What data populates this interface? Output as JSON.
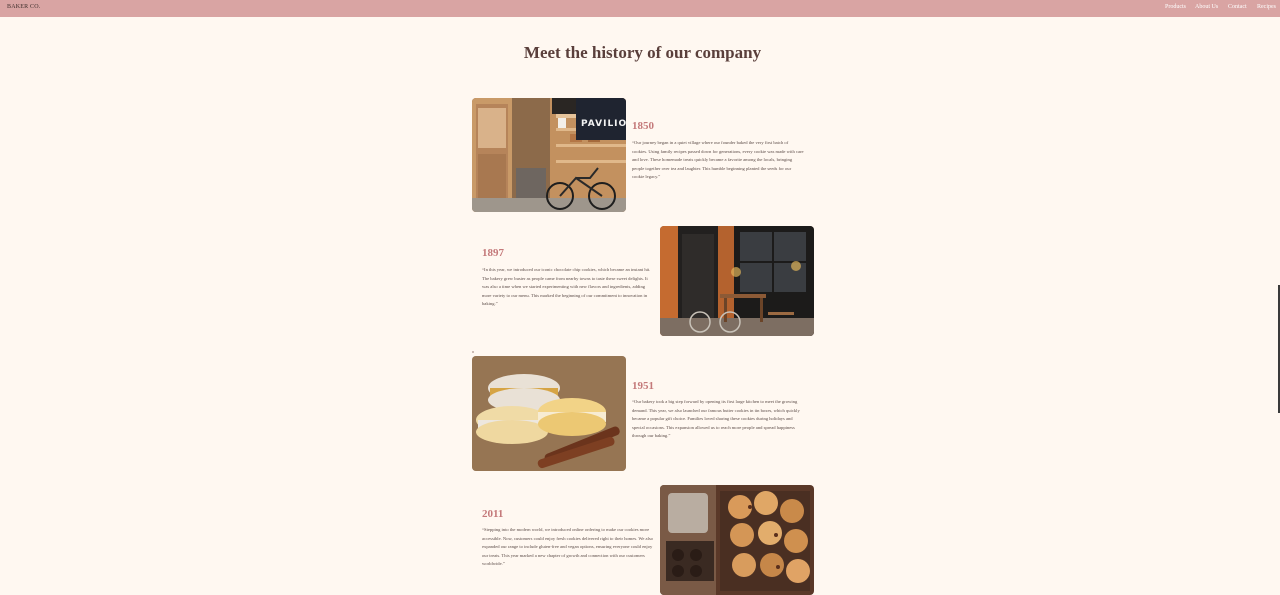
{
  "brand": "BAKER CO.",
  "nav": [
    "Products",
    "About Us",
    "Contact",
    "Recipes"
  ],
  "title": "Meet the history of our company",
  "timeline": [
    {
      "year": "1850",
      "text": "“Our journey began in a quiet village where our founder baked the very first batch of cookies. Using family recipes passed down for generations, every cookie was made with care and love. These homemade treats quickly became a favorite among the locals, bringing people together over tea and laughter. This humble beginning planted the seeds for our cookie legacy.”",
      "image": "bakery-storefront-with-bicycle",
      "sign": "PAVILIO"
    },
    {
      "year": "1897",
      "text": "“In this year, we introduced our iconic chocolate chip cookies, which became an instant hit. The bakery grew busier as people came from nearby towns to taste these sweet delights. It was also a time when we started experimenting with new flavors and ingredients, adding more variety to our menu. This marked the beginning of our commitment to innovation in baking.”",
      "image": "cafe-terrace-with-bicycle"
    },
    {
      "year": "1951",
      "text": "“Our bakery took a big step forward by opening its first large kitchen to meet the growing demand. This year, we also launched our famous butter cookies in tin boxes, which quickly became a popular gift choice. Families loved sharing these cookies during holidays and special occasions. This expansion allowed us to reach more people and spread happiness through our baking.”",
      "image": "macarons-with-cinnamon-sticks"
    },
    {
      "year": "2011",
      "text": "“Stepping into the modern world, we introduced online ordering to make our cookies more accessible. Now, customers could enjoy fresh cookies delivered right to their homes. We also expanded our range to include gluten-free and vegan options, ensuring everyone could enjoy our treats. This year marked a new chapter of growth and connection with our customers worldwide.”",
      "image": "assorted-cookies-tray"
    }
  ],
  "colors": {
    "navbar": "#d9a4a3",
    "background": "#fff8f1",
    "year": "#c4797a",
    "title": "#5a3f3b"
  }
}
